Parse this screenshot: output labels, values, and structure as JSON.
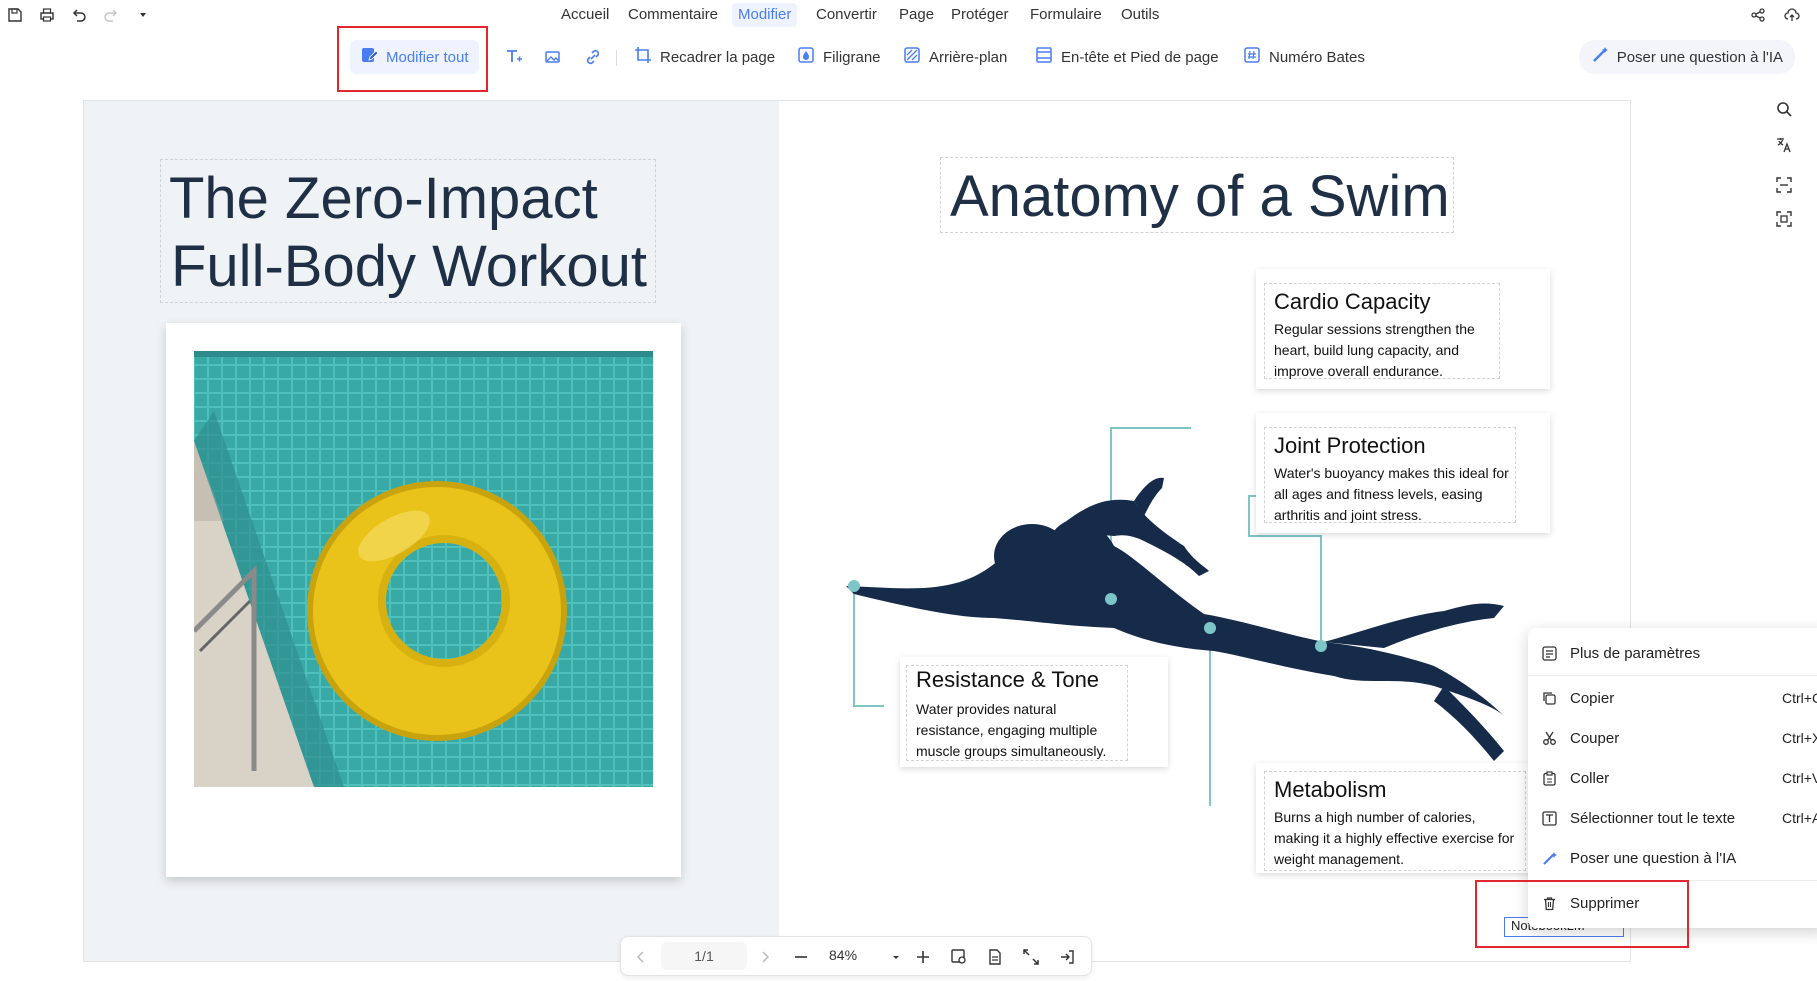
{
  "quick_access": {
    "save_icon": "save-icon",
    "print_icon": "print-icon",
    "undo_icon": "undo-icon",
    "redo_icon": "redo-icon",
    "dropdown_icon": "chevron-down-icon"
  },
  "menu": {
    "items": [
      "Accueil",
      "Commentaire",
      "Modifier",
      "Convertir",
      "Page",
      "Protéger",
      "Formulaire",
      "Outils"
    ],
    "active": "Modifier"
  },
  "toolbar": {
    "modifier_tout": "Modifier tout",
    "recadrer": "Recadrer la page",
    "filigrane": "Filigrane",
    "arriere_plan": "Arrière-plan",
    "entete": "En-tête et Pied de page",
    "bates": "Numéro Bates",
    "ask_ai": "Poser une question à l'IA"
  },
  "document": {
    "left_title_line1": "The Zero-Impact",
    "left_title_line2": "Full-Body Workout",
    "right_title": "Anatomy of a Swim",
    "cards": [
      {
        "title": "Cardio Capacity",
        "body": "Regular sessions strengthen the heart, build lung capacity, and improve overall endurance."
      },
      {
        "title": "Joint Protection",
        "body": "Water's buoyancy makes this ideal for all ages and fitness levels, easing arthritis and joint stress."
      },
      {
        "title": "Resistance & Tone",
        "body": "Water provides natural resistance, engaging multiple muscle groups simultaneously."
      },
      {
        "title": "Metabolism",
        "body": "Burns a high number of calories, making it a highly effective exercise for weight management."
      }
    ],
    "watermark_text": "NotebookLM"
  },
  "context_menu": {
    "items": [
      {
        "label": "Plus de paramètres",
        "shortcut": "",
        "icon": "settings-list-icon"
      },
      {
        "label": "Copier",
        "shortcut": "Ctrl+C",
        "icon": "copy-icon"
      },
      {
        "label": "Couper",
        "shortcut": "Ctrl+X",
        "icon": "scissors-icon"
      },
      {
        "label": "Coller",
        "shortcut": "Ctrl+V",
        "icon": "paste-icon"
      },
      {
        "label": "Sélectionner tout le texte",
        "shortcut": "Ctrl+A",
        "icon": "select-text-icon"
      },
      {
        "label": "Poser une question à l'IA",
        "shortcut": "",
        "icon": "ai-icon"
      },
      {
        "label": "Supprimer",
        "shortcut": "",
        "icon": "trash-icon"
      }
    ]
  },
  "bottom_bar": {
    "page": "1/1",
    "zoom": "84%"
  },
  "colors": {
    "accent": "#4a7ef0",
    "highlight_red": "#e3262e",
    "swimmer": "#162b4a",
    "connector": "#7cc6c8"
  }
}
